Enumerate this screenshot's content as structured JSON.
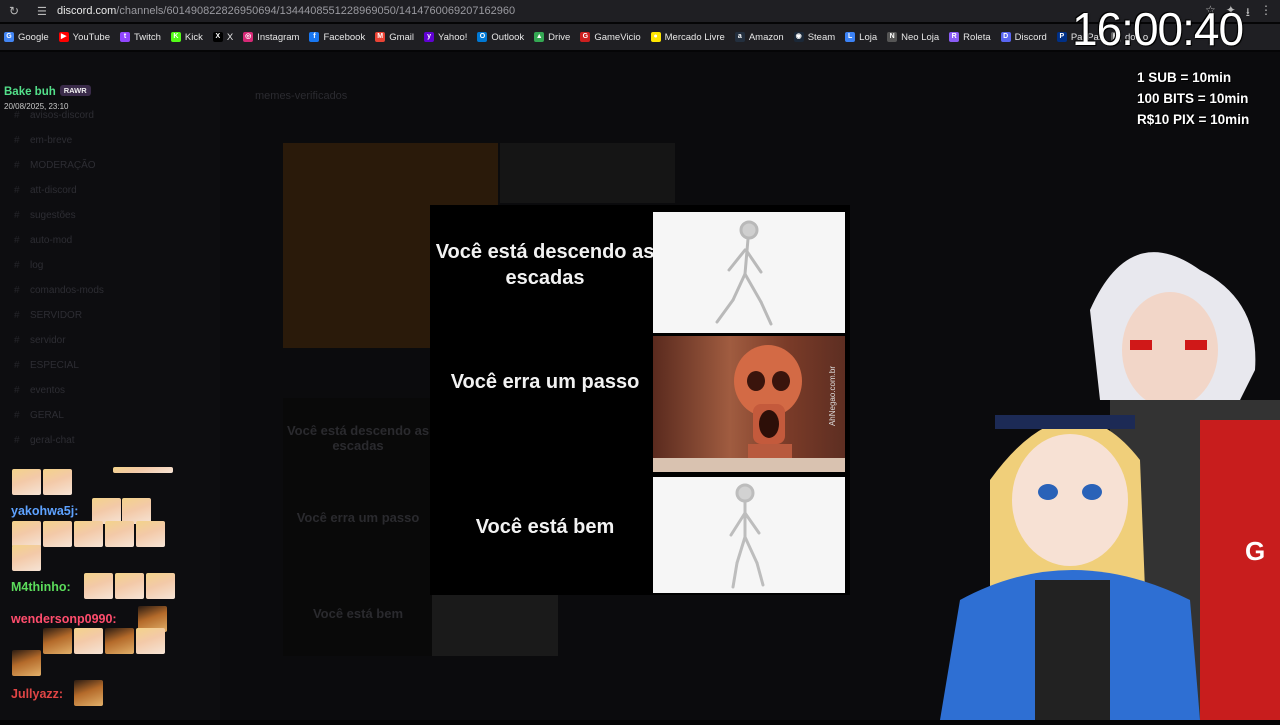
{
  "browser": {
    "url_host": "discord.com",
    "url_path": "/channels/601490822826950694/1344408551228969050/1414760069207162960",
    "bookmarks": [
      {
        "label": "Google",
        "color": "#4285f4",
        "glyph": "G"
      },
      {
        "label": "YouTube",
        "color": "#ff0000",
        "glyph": "▶"
      },
      {
        "label": "Twitch",
        "color": "#9146ff",
        "glyph": "t"
      },
      {
        "label": "Kick",
        "color": "#53fc18",
        "glyph": "K"
      },
      {
        "label": "X",
        "color": "#000000",
        "glyph": "X"
      },
      {
        "label": "Instagram",
        "color": "#d62976",
        "glyph": "◎"
      },
      {
        "label": "Facebook",
        "color": "#1877f2",
        "glyph": "f"
      },
      {
        "label": "Gmail",
        "color": "#ea4335",
        "glyph": "M"
      },
      {
        "label": "Yahoo!",
        "color": "#6001d2",
        "glyph": "y"
      },
      {
        "label": "Outlook",
        "color": "#0078d4",
        "glyph": "O"
      },
      {
        "label": "Drive",
        "color": "#34a853",
        "glyph": "▲"
      },
      {
        "label": "GameVicio",
        "color": "#cc1f1f",
        "glyph": "G"
      },
      {
        "label": "Mercado Livre",
        "color": "#ffe600",
        "glyph": "●"
      },
      {
        "label": "Amazon",
        "color": "#232f3e",
        "glyph": "a"
      },
      {
        "label": "Steam",
        "color": "#1b2838",
        "glyph": "◉"
      },
      {
        "label": "Loja",
        "color": "#3b82f6",
        "glyph": "L"
      },
      {
        "label": "Neo Loja",
        "color": "#555555",
        "glyph": "N"
      },
      {
        "label": "Roleta",
        "color": "#8b5cf6",
        "glyph": "R"
      },
      {
        "label": "Discord",
        "color": "#5865f2",
        "glyph": "D"
      },
      {
        "label": "PayPal",
        "color": "#003087",
        "glyph": "P"
      },
      {
        "label": "dos o",
        "color": "#666666",
        "glyph": "▣"
      }
    ]
  },
  "overlay": {
    "clock": "16:00:40",
    "prices": [
      "1 SUB = 10min",
      "100 BITS = 10min",
      "R$10 PIX = 10min"
    ]
  },
  "discord": {
    "channel_name": "memes-verificados",
    "channels": [
      "avisos-discord",
      "em-breve",
      "MODERAÇÃO",
      "att-discord",
      "sugestões",
      "auto-mod",
      "log",
      "comandos-mods",
      "SERVIDOR",
      "servidor",
      "ESPECIAL",
      "eventos",
      "GERAL",
      "geral-chat"
    ]
  },
  "chat": {
    "header_user": "Bake buh",
    "header_badge": "RAWR",
    "header_date": "20/08/2025, 23:10",
    "messages": [
      {
        "user": "yakohwa5j:",
        "color": "#5ea2ff"
      },
      {
        "user": "M4thinho:",
        "color": "#5bdc5b"
      },
      {
        "user": "wendersonp0990:",
        "color": "#ff4d6d"
      },
      {
        "user": "Jullyazz:",
        "color": "#e04545"
      }
    ]
  },
  "meme": {
    "captions": [
      "Você está descendo as escadas",
      "Você erra um passo",
      "Você está bem"
    ],
    "watermark": "AhNegao.com.br"
  },
  "ghost_meme": {
    "captions": [
      "Você está descendo as escadas",
      "Você erra um passo",
      "Você está bem"
    ]
  }
}
